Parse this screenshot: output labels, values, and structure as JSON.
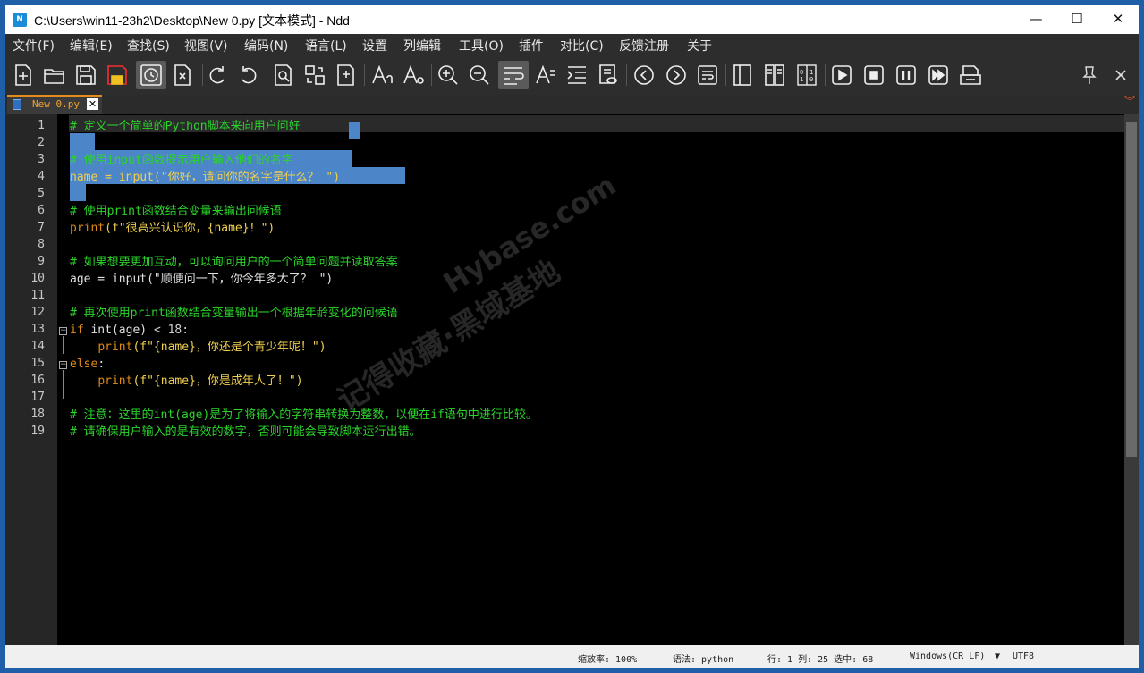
{
  "window": {
    "title": "C:\\Users\\win11-23h2\\Desktop\\New 0.py [文本模式] - Ndd",
    "app_icon": "ndd-app-icon",
    "minimize": "—",
    "maximize": "☐",
    "close": "✕"
  },
  "menu": [
    "文件(F)",
    "编辑(E)",
    "查找(S)",
    "视图(V)",
    "编码(N)",
    "语言(L)",
    "设置",
    "列编辑",
    "工具(O)",
    "插件",
    "对比(C)",
    "反馈注册",
    "关于"
  ],
  "toolbar": {
    "icons": [
      "new-file-icon",
      "open-folder-icon",
      "save-icon",
      "save-all-icon",
      "history-icon",
      "close-file-icon",
      "undo-icon",
      "redo-icon",
      "find-icon",
      "replace-icon",
      "goto-icon",
      "text-case-upper-icon",
      "text-case-lower-icon",
      "zoom-in-icon",
      "zoom-out-icon",
      "word-wrap-icon",
      "show-symbols-icon",
      "indent-icon",
      "preview-icon",
      "prev-icon",
      "next-icon",
      "wrap-lines-icon",
      "compare-left-icon",
      "compare-files-icon",
      "binary-icon",
      "play-icon",
      "stop-icon",
      "pause-icon",
      "fast-forward-icon",
      "macro-icon"
    ],
    "pin_icon": "pin-icon",
    "close_icon": "toolbar-close-icon"
  },
  "tab": {
    "label": "New 0.py",
    "close": "✕"
  },
  "editor": {
    "line_numbers": [
      "1",
      "2",
      "3",
      "4",
      "5",
      "6",
      "7",
      "8",
      "9",
      "10",
      "11",
      "12",
      "13",
      "14",
      "15",
      "16",
      "17",
      "18",
      "19"
    ],
    "lines": [
      [
        "# 定义一个简单的Python脚本来向用户问好"
      ],
      [
        ""
      ],
      [
        "# 使用input函数提示用户输入他们的名字"
      ],
      [
        "name = input(\"你好，请问你的名字是什么？ \")"
      ],
      [
        ""
      ],
      [
        "# 使用print函数结合变量来输出问候语"
      ],
      [
        "print",
        "(f\"很高兴认识你，{name}！\")"
      ],
      [
        ""
      ],
      [
        "# 如果想要更加互动，可以询问用户的一个简单问题并读取答案"
      ],
      [
        "age = input(\"顺便问一下，你今年多大了？ \")"
      ],
      [
        ""
      ],
      [
        "# 再次使用print函数结合变量输出一个根据年龄变化的问候语"
      ],
      [
        "if",
        " int(age) ",
        "< 18:"
      ],
      [
        "    ",
        "print",
        "(f\"{name}，你还是个青少年呢！\")"
      ],
      [
        "else",
        ":"
      ],
      [
        "    ",
        "print",
        "(f\"{name}，你是成年人了！\")"
      ],
      [
        ""
      ],
      [
        "# 注意：这里的int(age)是为了将输入的字符串转换为整数，以便在if语句中进行比较。"
      ],
      [
        "# 请确保用户输入的是有效的数字，否则可能会导致脚本运行出错。"
      ]
    ]
  },
  "watermark": {
    "line1": "记得收藏·黑域基地",
    "line2": "Hybase.com"
  },
  "status": {
    "zoom": "缩放率: 100%",
    "syntax": "语法: python",
    "position": "行: 1 列: 25 选中: 68",
    "eol": "Windows(CR LF)",
    "eol_dropdown": "▼",
    "encoding": "UTF8"
  }
}
